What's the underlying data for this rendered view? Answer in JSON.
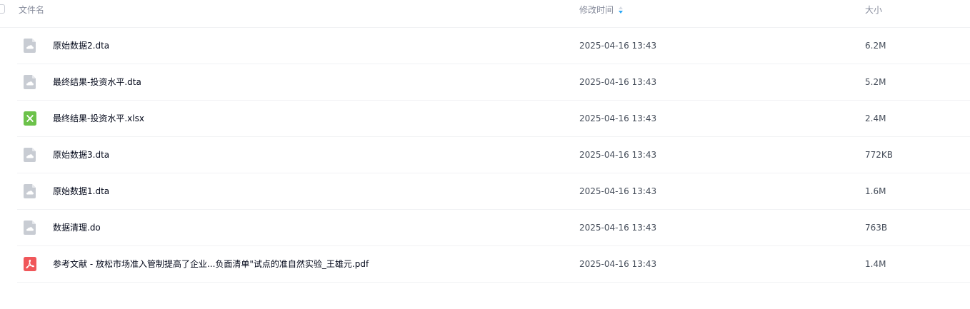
{
  "header": {
    "name_label": "文件名",
    "time_label": "修改时间",
    "size_label": "大小"
  },
  "files": [
    {
      "name": "原始数据2.dta",
      "time": "2025-04-16 13:43",
      "size": "6.2M",
      "icon": "generic-file-icon"
    },
    {
      "name": "最终结果-投资水平.dta",
      "time": "2025-04-16 13:43",
      "size": "5.2M",
      "icon": "generic-file-icon"
    },
    {
      "name": "最终结果-投资水平.xlsx",
      "time": "2025-04-16 13:43",
      "size": "2.4M",
      "icon": "excel-file-icon"
    },
    {
      "name": "原始数据3.dta",
      "time": "2025-04-16 13:43",
      "size": "772KB",
      "icon": "generic-file-icon"
    },
    {
      "name": "原始数据1.dta",
      "time": "2025-04-16 13:43",
      "size": "1.6M",
      "icon": "generic-file-icon"
    },
    {
      "name": "数据清理.do",
      "time": "2025-04-16 13:43",
      "size": "763B",
      "icon": "generic-file-icon"
    },
    {
      "name": "参考文献 - 放松市场准入管制提高了企业...负面清单\"试点的准自然实验_王雄元.pdf",
      "time": "2025-04-16 13:43",
      "size": "1.4M",
      "icon": "pdf-file-icon"
    }
  ],
  "colors": {
    "sort_active": "#2aa7f5",
    "excel": "#6cc24a",
    "pdf": "#f0575a",
    "generic": "#c8ccd3"
  }
}
